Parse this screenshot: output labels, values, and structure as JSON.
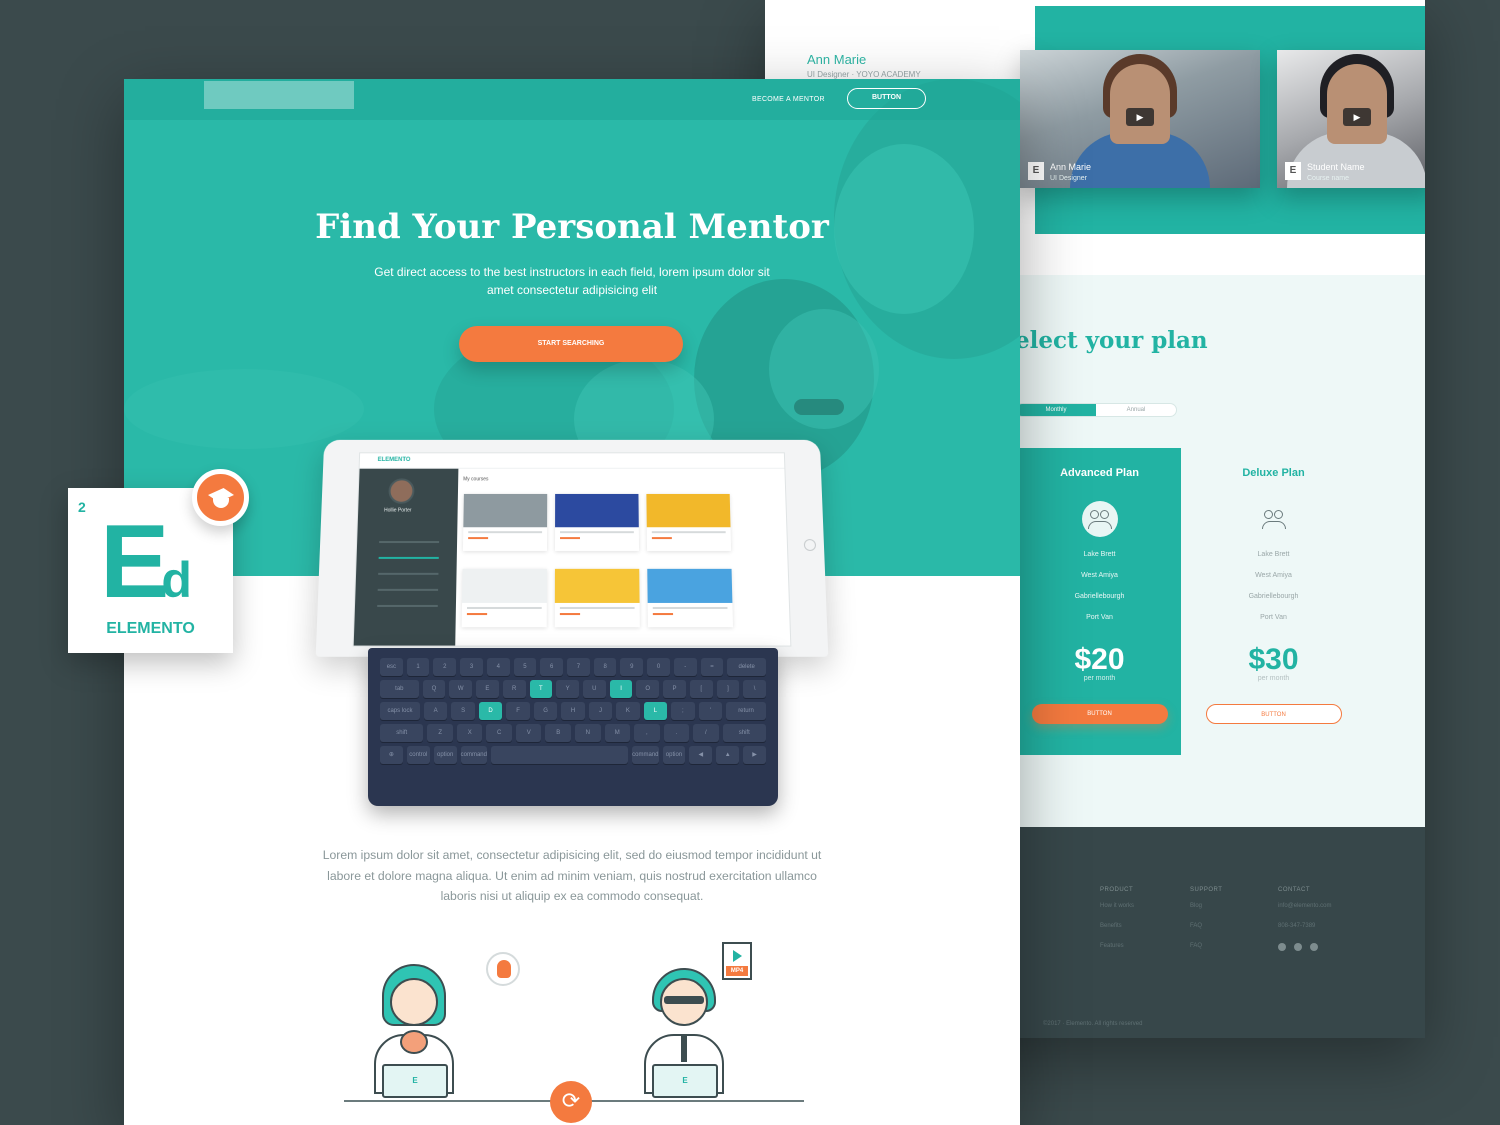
{
  "colors": {
    "teal": "#22b3a3",
    "orange": "#f47a3f",
    "dark": "#3b4a4c"
  },
  "back": {
    "mentor_name": "Ann Marie",
    "mentor_sub": "UI Designer · YOYO ACADEMY",
    "videos": [
      {
        "name": "Ann Marie",
        "sub": "UI Designer",
        "badge": "E"
      },
      {
        "name": "Student Name",
        "sub": "Course name",
        "badge": "E"
      }
    ],
    "plan_title": "elect your plan",
    "toggle": [
      "Monthly",
      "Annual"
    ],
    "plans": [
      {
        "name": "Advanced Plan",
        "features": [
          "Lake Brett",
          "West Amiya",
          "Gabriellebourgh",
          "Port Van"
        ],
        "price": "$20",
        "per": "per month",
        "button": "BUTTON"
      },
      {
        "name": "Deluxe Plan",
        "features": [
          "Lake Brett",
          "West Amiya",
          "Gabriellebourgh",
          "Port Van"
        ],
        "price": "$30",
        "per": "per month",
        "button": "BUTTON"
      }
    ],
    "footer": {
      "product": {
        "head": "PRODUCT",
        "links": [
          "How it works",
          "Benefits",
          "Features"
        ]
      },
      "support": {
        "head": "SUPPORT",
        "links": [
          "Blog",
          "FAQ",
          "FAQ"
        ]
      },
      "contact": {
        "head": "CONTACT",
        "links": [
          "info@elemento.com",
          "808-347-7389"
        ]
      },
      "copyright": "©2017 · Elemento. All rights reserved"
    }
  },
  "front": {
    "nav": {
      "link": "BECOME A MENTOR",
      "button": "BUTTON"
    },
    "hero_title": "Find Your Personal Mentor",
    "hero_sub": "Get direct access to the best instructors in each field, lorem ipsum dolor sit amet consectetur adipisicing elit",
    "cta": "START SEARCHING",
    "tablet": {
      "logo": "ELEMENTO",
      "user": "Hollie Porter",
      "heading": "My courses"
    },
    "keyboard": [
      [
        "esc",
        "1",
        "2",
        "3",
        "4",
        "5",
        "6",
        "7",
        "8",
        "9",
        "0",
        "-",
        "=",
        "delete"
      ],
      [
        "tab",
        "Q",
        "W",
        "E",
        "R",
        "T",
        "Y",
        "U",
        "I",
        "O",
        "P",
        "[",
        "]",
        "\\"
      ],
      [
        "caps lock",
        "A",
        "S",
        "D",
        "F",
        "G",
        "H",
        "J",
        "K",
        "L",
        ";",
        "'",
        "return"
      ],
      [
        "shift",
        "Z",
        "X",
        "C",
        "V",
        "B",
        "N",
        "M",
        ",",
        ".",
        "/",
        "shift"
      ],
      [
        "⊕",
        "control",
        "option",
        "command",
        "",
        "command",
        "option",
        "◀",
        "▲",
        "▶"
      ]
    ],
    "paragraph": "Lorem ipsum dolor sit amet, consectetur adipisicing elit, sed do eiusmod tempor incididunt ut labore et dolore magna aliqua. Ut enim ad minim veniam, quis nostrud exercitation ullamco laboris nisi ut aliquip ex ea commodo consequat.",
    "laptop_letter": "E",
    "file_tag": "MP4"
  },
  "badge": {
    "number": "2",
    "symbol_big": "E",
    "symbol_small": "d",
    "name": "ELEMENTO"
  },
  "icons": [
    "play-icon",
    "graduation-cap-icon",
    "lightbulb-icon",
    "video-file-icon",
    "sync-icon",
    "mentor-group-icon",
    "facebook-icon",
    "instagram-icon",
    "twitter-icon"
  ]
}
